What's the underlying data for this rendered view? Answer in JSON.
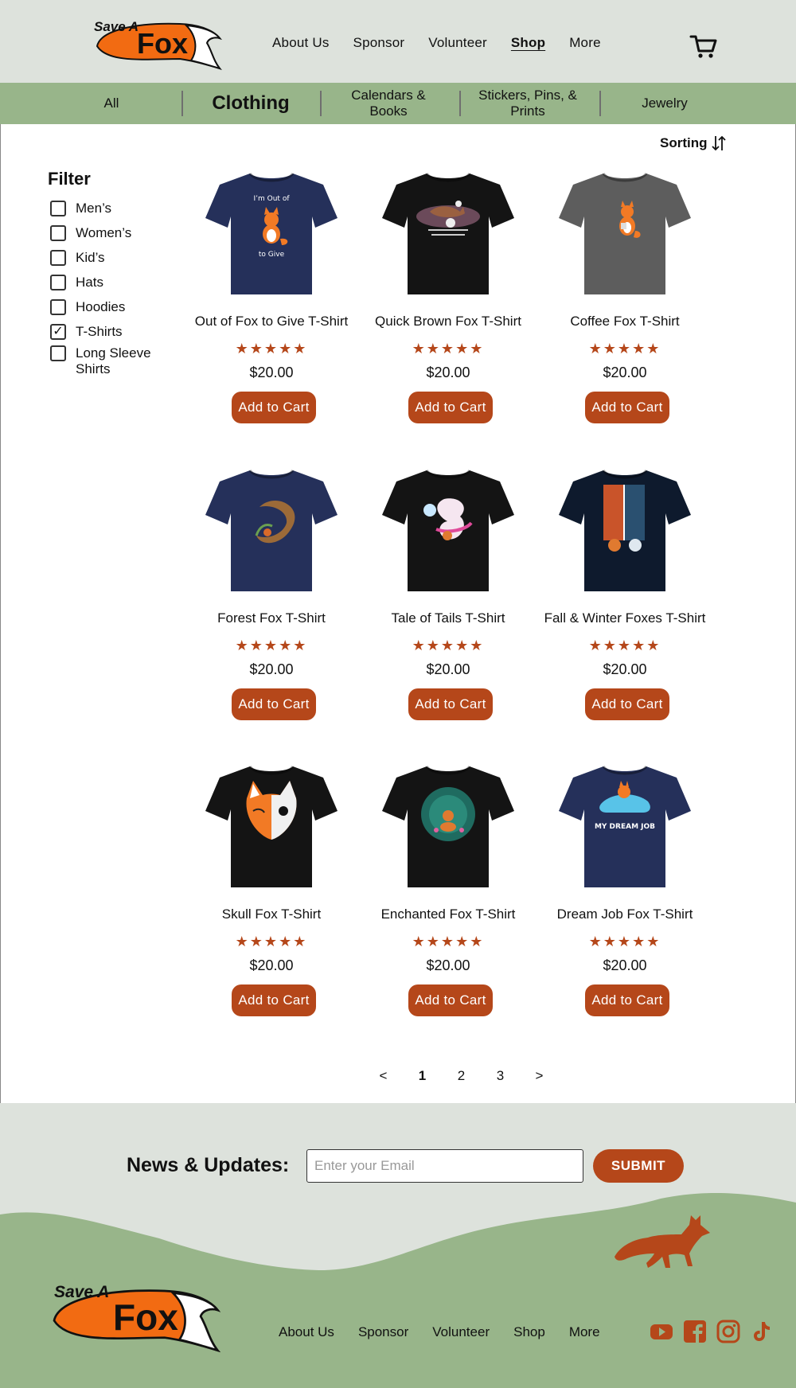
{
  "brand": {
    "name_top": "Save A",
    "name_main": "Fox",
    "accent": "#b5471a",
    "orange": "#f26b12",
    "header_bg": "#dde2dc",
    "green": "#98b58a"
  },
  "header": {
    "nav": [
      {
        "label": "About Us",
        "active": false
      },
      {
        "label": "Sponsor",
        "active": false
      },
      {
        "label": "Volunteer",
        "active": false
      },
      {
        "label": "Shop",
        "active": true
      },
      {
        "label": "More",
        "active": false
      }
    ],
    "cart_icon": "cart-icon"
  },
  "categories": [
    {
      "label": "All"
    },
    {
      "label": "Clothing",
      "active": true
    },
    {
      "label": "Calendars & Books"
    },
    {
      "label": "Stickers, Pins, & Prints"
    },
    {
      "label": "Jewelry"
    }
  ],
  "sorting": {
    "label": "Sorting",
    "icon": "sort-arrows-icon"
  },
  "filter": {
    "title": "Filter",
    "options": [
      {
        "label": "Men’s",
        "checked": false
      },
      {
        "label": "Women’s",
        "checked": false
      },
      {
        "label": "Kid’s",
        "checked": false
      },
      {
        "label": "Hats",
        "checked": false
      },
      {
        "label": "Hoodies",
        "checked": false
      },
      {
        "label": "T-Shirts",
        "checked": true
      },
      {
        "label": "Long Sleeve Shirts",
        "checked": false
      }
    ]
  },
  "products": [
    {
      "name": "Out of Fox to Give T-Shirt",
      "stars": "★★★★★",
      "price": "$20.00",
      "button": "Add to Cart",
      "shirt_color": "#25305a",
      "art": "fox-sitting",
      "shirt_text": "I’m Out of\nto Give"
    },
    {
      "name": "Quick Brown Fox T-Shirt",
      "stars": "★★★★★",
      "price": "$20.00",
      "button": "Add to Cart",
      "shirt_color": "#141414",
      "art": "fox-jumping-moon",
      "shirt_text": ""
    },
    {
      "name": "Coffee Fox T-Shirt",
      "stars": "★★★★★",
      "price": "$20.00",
      "button": "Add to Cart",
      "shirt_color": "#5d5d5d",
      "art": "fox-coffee",
      "shirt_text": ""
    },
    {
      "name": "Forest Fox T-Shirt",
      "stars": "★★★★★",
      "price": "$20.00",
      "button": "Add to Cart",
      "shirt_color": "#25305a",
      "art": "fox-curled-forest",
      "shirt_text": ""
    },
    {
      "name": "Tale of Tails T-Shirt",
      "stars": "★★★★★",
      "price": "$20.00",
      "button": "Add to Cart",
      "shirt_color": "#141414",
      "art": "fox-tails-magic",
      "shirt_text": ""
    },
    {
      "name": "Fall & Winter Foxes T-Shirt",
      "stars": "★★★★★",
      "price": "$20.00",
      "button": "Add to Cart",
      "shirt_color": "#0e1a2d",
      "art": "fox-fall-winter",
      "shirt_text": ""
    },
    {
      "name": "Skull Fox T-Shirt",
      "stars": "★★★★★",
      "price": "$20.00",
      "button": "Add to Cart",
      "shirt_color": "#141414",
      "art": "fox-skull",
      "shirt_text": ""
    },
    {
      "name": "Enchanted Fox T-Shirt",
      "stars": "★★★★★",
      "price": "$20.00",
      "button": "Add to Cart",
      "shirt_color": "#141414",
      "art": "fox-enchanted-forest",
      "shirt_text": ""
    },
    {
      "name": "Dream Job Fox T-Shirt",
      "stars": "★★★★★",
      "price": "$20.00",
      "button": "Add to Cart",
      "shirt_color": "#25305a",
      "art": "fox-sleeping",
      "shirt_text": "MY DREAM JOB"
    }
  ],
  "pagination": {
    "prev": "<",
    "pages": [
      "1",
      "2",
      "3"
    ],
    "current": "1",
    "next": ">"
  },
  "footer": {
    "news_title": "News & Updates:",
    "email_placeholder": "Enter your Email",
    "submit_label": "SUBMIT",
    "nav": [
      "About Us",
      "Sponsor",
      "Volunteer",
      "Shop",
      "More"
    ],
    "socials": [
      "youtube-icon",
      "facebook-icon",
      "instagram-icon",
      "tiktok-icon"
    ]
  }
}
